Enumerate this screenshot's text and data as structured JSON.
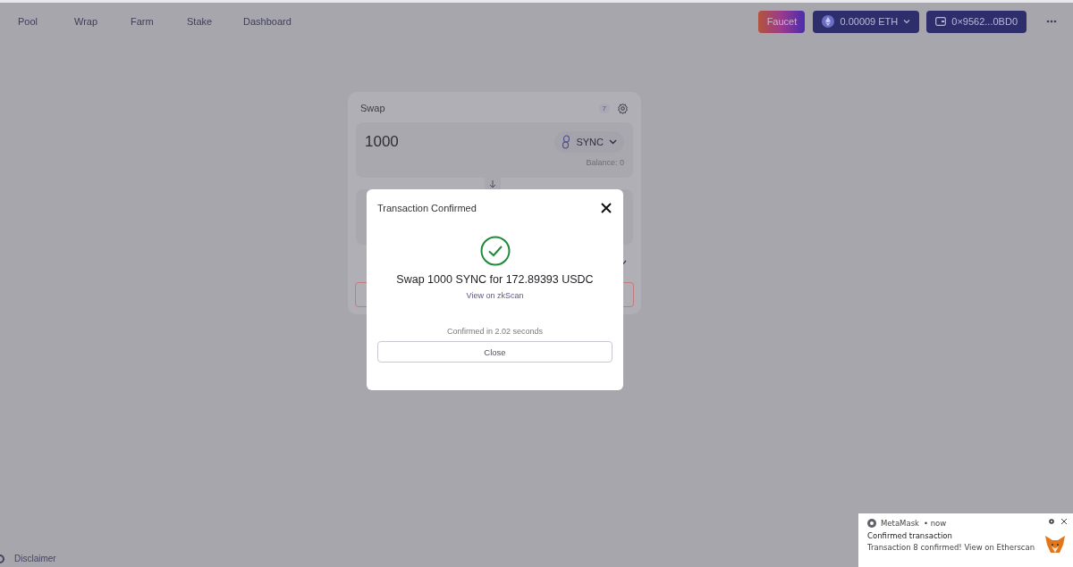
{
  "nav": {
    "links": [
      "Pool",
      "Wrap",
      "Farm",
      "Stake",
      "Dashboard"
    ],
    "faucet": "Faucet",
    "balance": "0.00009 ETH",
    "wallet": "0×9562...0BD0"
  },
  "swap": {
    "title": "Swap",
    "slippage": "7",
    "amount": "1000",
    "token": "SYNC",
    "balance": "Balance: 0"
  },
  "modal": {
    "title": "Transaction Confirmed",
    "message": "Swap 1000 SYNC for 172.89393 USDC",
    "link": "View on zkScan",
    "time": "Confirmed in 2.02 seconds",
    "button": "Close"
  },
  "footer": {
    "link": "Disclaimer"
  },
  "notification": {
    "app": "MetaMask",
    "when": "• now",
    "title": "Confirmed transaction",
    "body": "Transaction 8 confirmed! View on Etherscan"
  }
}
